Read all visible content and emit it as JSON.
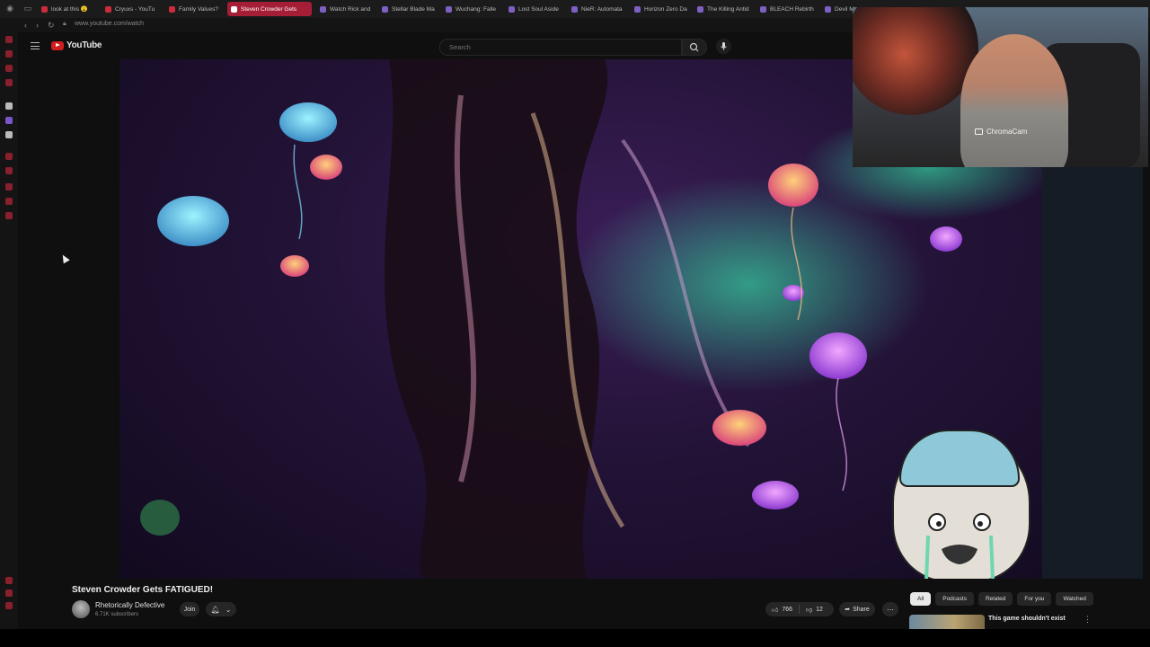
{
  "browser": {
    "tabs": [
      {
        "label": "look at this 😮"
      },
      {
        "label": "Cryuxs - YouTu"
      },
      {
        "label": "Family Values?"
      },
      {
        "label": "Steven Crowder Gets",
        "active": true
      },
      {
        "label": "Watch Rick and"
      },
      {
        "label": "Stellar Blade Ma"
      },
      {
        "label": "Wuchang: Falle"
      },
      {
        "label": "Lost Soul Aside"
      },
      {
        "label": "NieR: Automata"
      },
      {
        "label": "Horizon Zero Da"
      },
      {
        "label": "The Killing Antid"
      },
      {
        "label": "BLEACH Rebirth"
      },
      {
        "label": "Devil M"
      }
    ],
    "url": "www.youtube.com/watch"
  },
  "youtube": {
    "logo_text": "YouTube",
    "search_placeholder": "Search"
  },
  "webcam": {
    "label": "ChromaCam"
  },
  "video": {
    "title": "Steven Crowder Gets FATIGUED!",
    "channel_name": "Rhetorically Defective",
    "subscribers": "6.71K subscribers",
    "join_label": "Join",
    "likes": "766",
    "dislikes": "12",
    "share_label": "Share"
  },
  "sidebar_right": {
    "chips": [
      "All",
      "Podcasts",
      "Related",
      "For you",
      "Watched"
    ],
    "active_chip": "All",
    "recommendation_title": "This game shouldn't exist"
  },
  "colors": {
    "accent": "#a51e36",
    "youtube_red": "#d11d1d",
    "background": "#0f0f0f"
  }
}
